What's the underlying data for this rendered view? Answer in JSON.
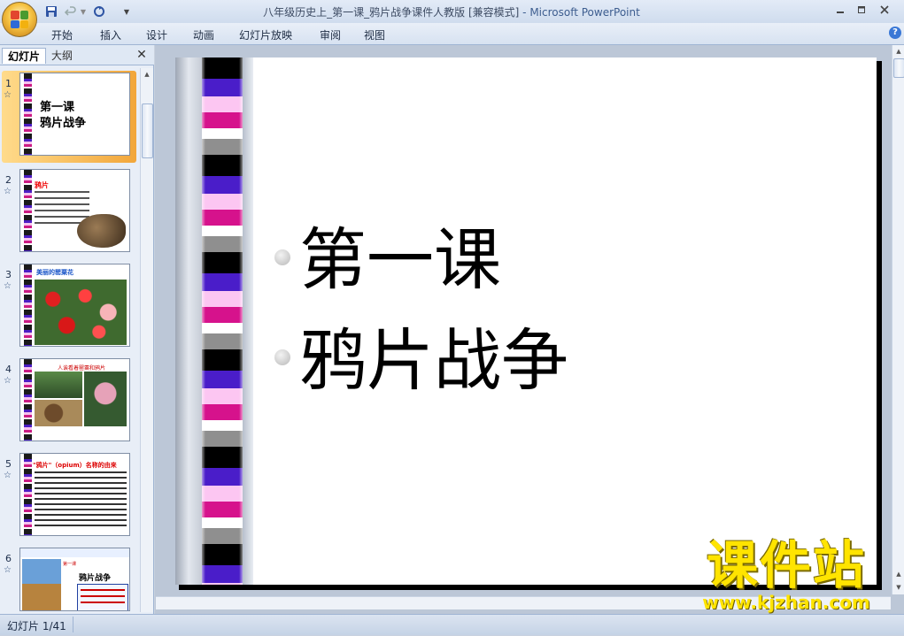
{
  "window": {
    "title": "八年级历史上_第一课_鸦片战争课件人教版 [兼容模式]",
    "app_suffix": " - Microsoft PowerPoint"
  },
  "ribbon": {
    "tabs": [
      "开始",
      "插入",
      "设计",
      "动画",
      "幻灯片放映",
      "审阅",
      "视图"
    ]
  },
  "left_pane": {
    "tabs": [
      "幻灯片",
      "大纲"
    ],
    "thumbnails": [
      {
        "number": "1",
        "text_lines": [
          "第一课",
          "鸦片战争"
        ]
      },
      {
        "number": "2",
        "title": "鸦片"
      },
      {
        "number": "3",
        "title": "美丽的罂粟花"
      },
      {
        "number": "4",
        "title": "人诶看着罂粟和鸦片"
      },
      {
        "number": "5",
        "title": "\"鸦片\"（opium）名称的由来"
      },
      {
        "number": "6",
        "tag": "第一课",
        "title": "鸦片战争"
      }
    ]
  },
  "slide": {
    "lines": [
      "第一课",
      "鸦片战争"
    ]
  },
  "watermark": {
    "text": "课件站",
    "url": "www.kjzhan.com"
  },
  "status": {
    "slide_indicator": "幻灯片 1/41"
  },
  "colors": {
    "film_black": "#000000",
    "film_purple": "#4a1dc9",
    "film_pink": "#fcc6f2",
    "film_magenta": "#d6128c",
    "watermark_yellow": "#ffe400"
  }
}
